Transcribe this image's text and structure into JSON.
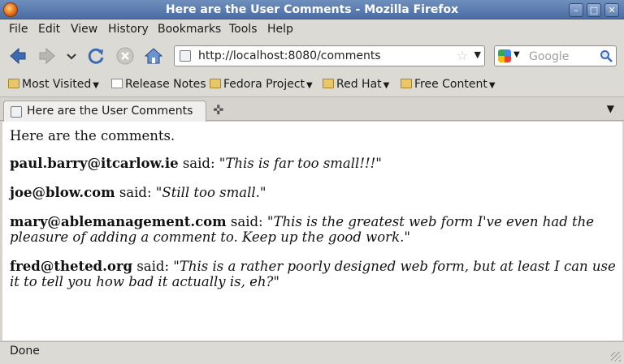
{
  "window": {
    "title": "Here are the User Comments - Mozilla Firefox"
  },
  "menu": [
    "File",
    "Edit",
    "View",
    "History",
    "Bookmarks",
    "Tools",
    "Help"
  ],
  "nav": {
    "url": "http://localhost:8080/comments",
    "search_placeholder": "Google"
  },
  "bookmarks": [
    "Most Visited",
    "Release Notes",
    "Fedora Project",
    "Red Hat",
    "Free Content"
  ],
  "tab": {
    "label": "Here are the User Comments"
  },
  "page": {
    "intro": "Here are the comments.",
    "comments": [
      {
        "email": "paul.barry@itcarlow.ie",
        "said": " said: \"",
        "text": "This is far too small!!!",
        "close": "\""
      },
      {
        "email": "joe@blow.com",
        "said": " said: \"",
        "text": "Still too small.",
        "close": "\""
      },
      {
        "email": "mary@ablemanagement.com",
        "said": " said: \"",
        "text": "This is the greatest web form I've even had the pleasure of adding a comment to. Keep up the good work.",
        "close": "\""
      },
      {
        "email": "fred@theted.org",
        "said": " said: \"",
        "text": "This is a rather poorly designed web form, but at least I can use it to tell you how bad it actually is, eh?",
        "close": "\""
      }
    ]
  },
  "status": "Done"
}
